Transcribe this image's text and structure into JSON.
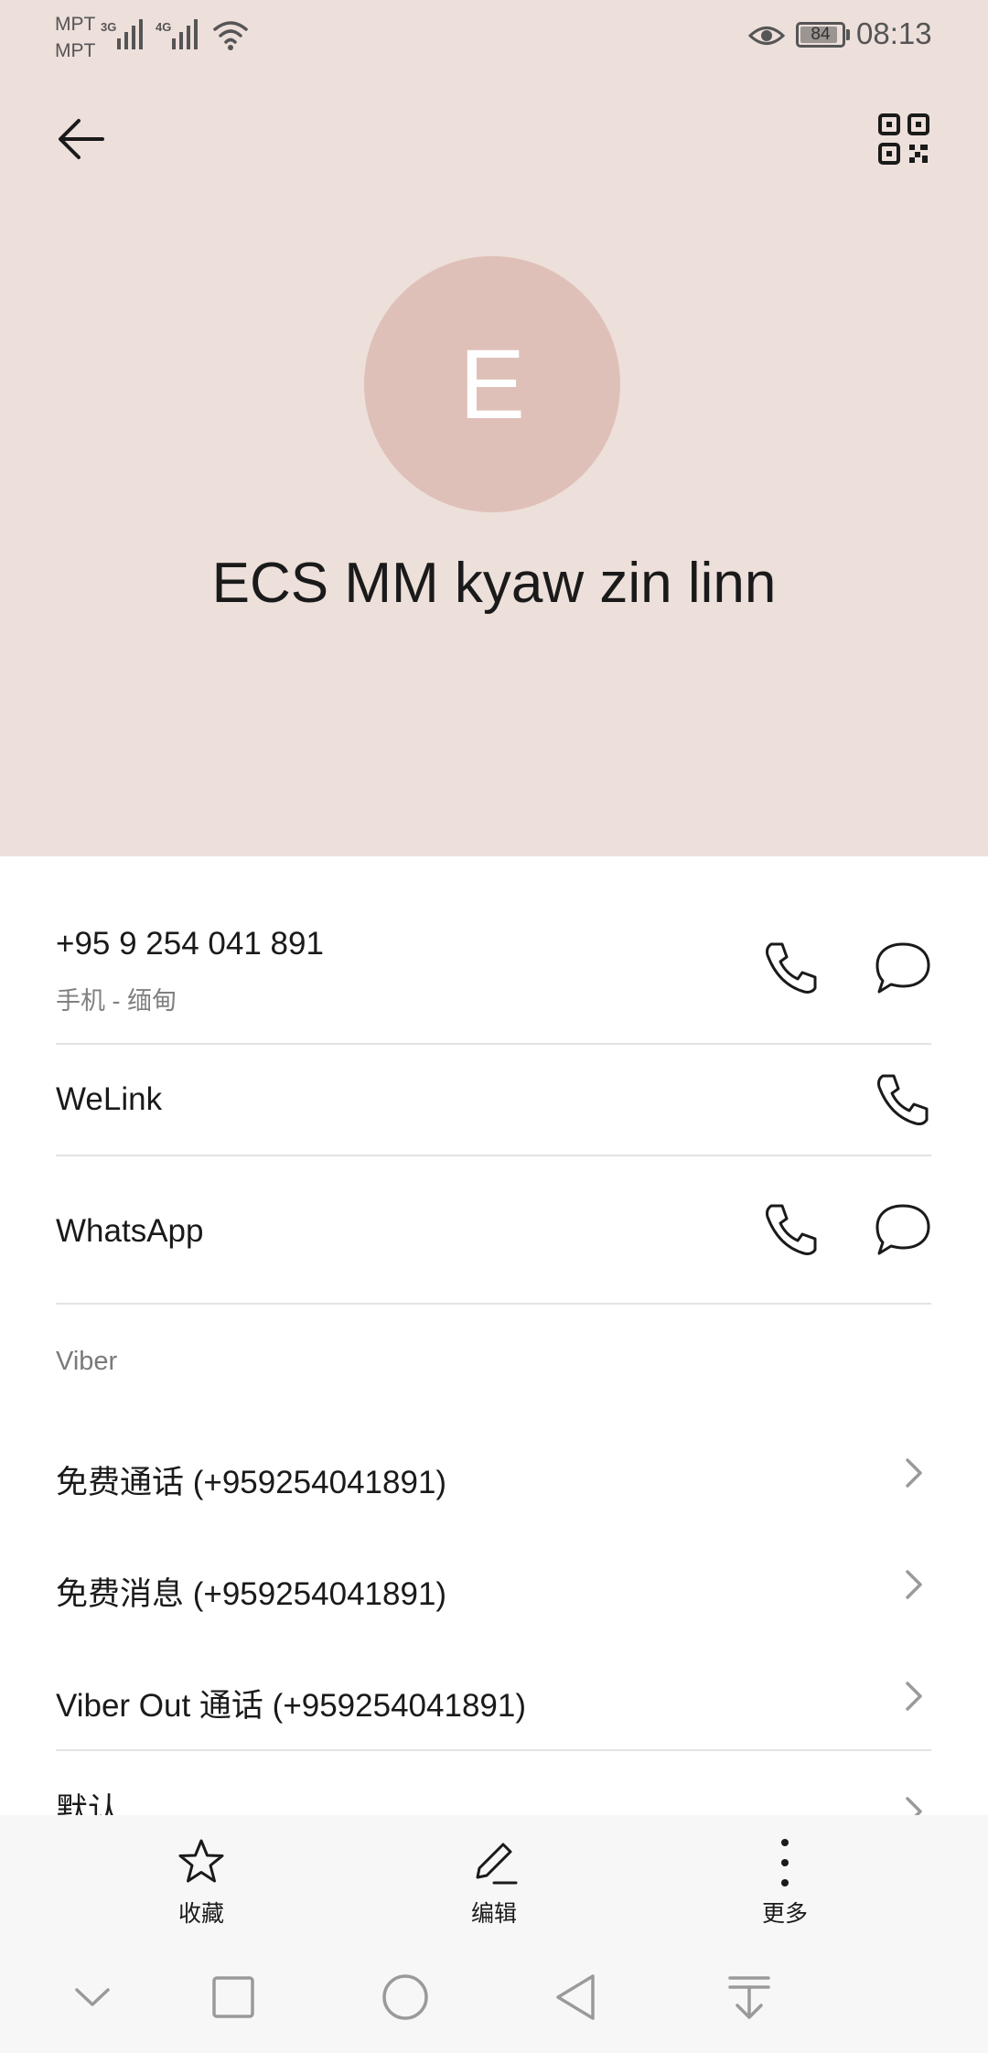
{
  "status_bar": {
    "carrier_1": "MPT",
    "carrier_2": "MPT",
    "network_1": "3G",
    "network_2": "4G",
    "battery": "84",
    "time": "08:13",
    "icons": [
      "signal-icon",
      "wifi-icon",
      "eye-icon",
      "battery-icon"
    ]
  },
  "header": {
    "background": "#eddfda",
    "back_icon": "arrow-left-icon",
    "qr_icon": "qr-code-icon",
    "avatar_letter": "E",
    "avatar_color": "#dfc0b8",
    "contact_name": "ECS MM kyaw zin linn"
  },
  "phone": {
    "number": "+95 9 254 041 891",
    "label": "手机 - 缅甸",
    "icons": [
      "phone-icon",
      "message-icon"
    ]
  },
  "welink": {
    "label": "WeLink",
    "icons": [
      "phone-icon"
    ]
  },
  "whatsapp": {
    "label": "WhatsApp",
    "icons": [
      "phone-icon",
      "message-icon"
    ]
  },
  "viber": {
    "title": "Viber",
    "items": [
      {
        "label": "免费通话 (+959254041891)"
      },
      {
        "label": "免费消息 (+959254041891)"
      },
      {
        "label": "Viber Out 通话 (+959254041891)"
      }
    ]
  },
  "default_row": {
    "label": "默认"
  },
  "bottom_actions": [
    {
      "label": "收藏",
      "icon": "star-icon"
    },
    {
      "label": "编辑",
      "icon": "pencil-icon"
    },
    {
      "label": "更多",
      "icon": "more-vertical-icon"
    }
  ],
  "nav_bar": {
    "icons": [
      "chevron-down-icon",
      "square-icon",
      "circle-icon",
      "triangle-back-icon",
      "download-arrow-icon"
    ]
  }
}
